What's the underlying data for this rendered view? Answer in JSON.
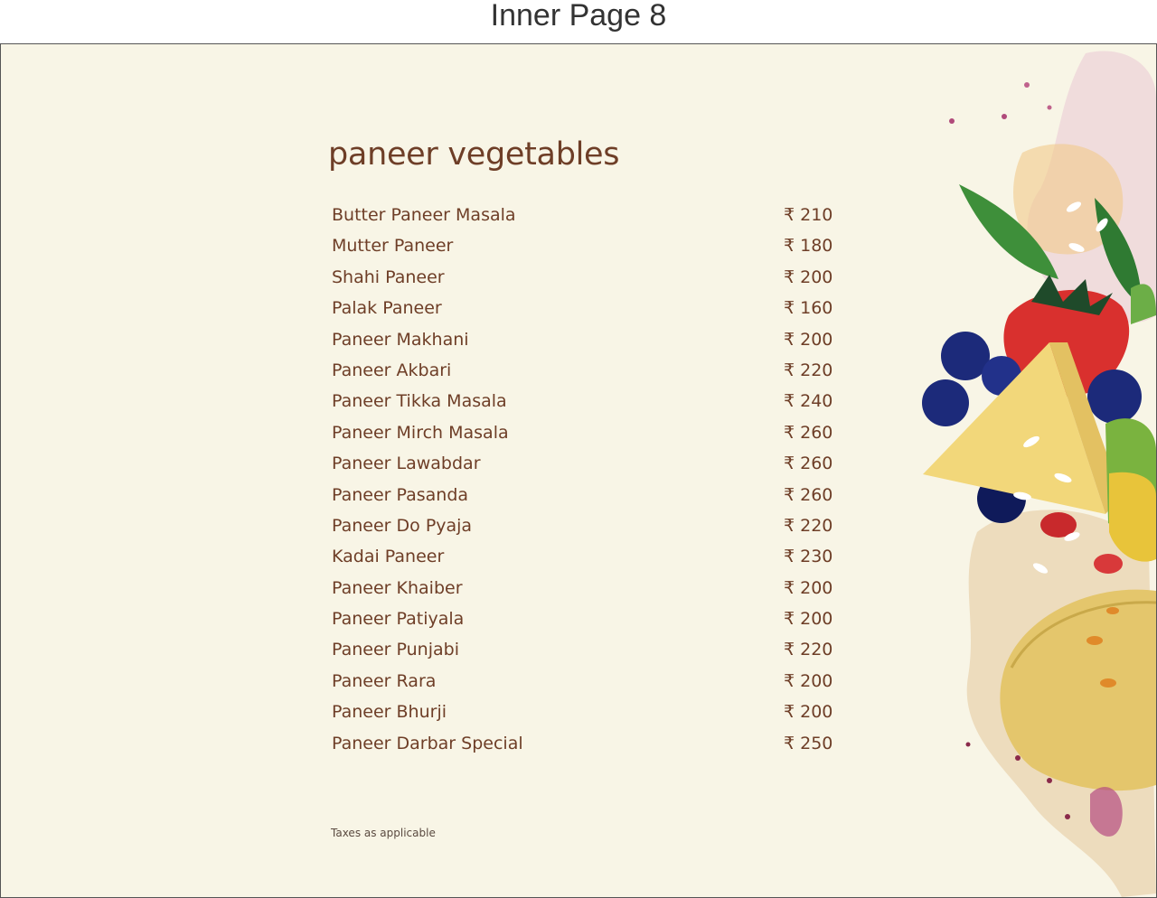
{
  "caption": "Inner Page 8",
  "section_title": "paneer vegetables",
  "currency_symbol": "₹",
  "items": [
    {
      "name": "Butter Paneer Masala",
      "price": "₹ 210"
    },
    {
      "name": "Mutter Paneer",
      "price": "₹ 180"
    },
    {
      "name": "Shahi Paneer",
      "price": "₹ 200"
    },
    {
      "name": "Palak Paneer",
      "price": "₹ 160"
    },
    {
      "name": "Paneer Makhani",
      "price": "₹ 200"
    },
    {
      "name": "Paneer Akbari",
      "price": "₹ 220"
    },
    {
      "name": "Paneer Tikka Masala",
      "price": "₹ 240"
    },
    {
      "name": "Paneer Mirch Masala",
      "price": "₹ 260"
    },
    {
      "name": "Paneer Lawabdar",
      "price": "₹ 260"
    },
    {
      "name": "Paneer Pasanda",
      "price": "₹ 260"
    },
    {
      "name": "Paneer Do Pyaja",
      "price": "₹ 220"
    },
    {
      "name": "Kadai Paneer",
      "price": "₹ 230"
    },
    {
      "name": "Paneer Khaiber",
      "price": "₹ 200"
    },
    {
      "name": "Paneer Patiyala",
      "price": "₹ 200"
    },
    {
      "name": "Paneer Punjabi",
      "price": "₹ 220"
    },
    {
      "name": "Paneer Rara",
      "price": "₹ 200"
    },
    {
      "name": "Paneer Bhurji",
      "price": "₹ 200"
    },
    {
      "name": "Paneer Darbar Special",
      "price": "₹ 250"
    }
  ],
  "footer_note": "Taxes as applicable",
  "colors": {
    "page_background": "#f8f5e6",
    "text_brown": "#6e3e27",
    "caption_text": "#333333"
  },
  "decoration": "watercolor-fruit-illustration"
}
